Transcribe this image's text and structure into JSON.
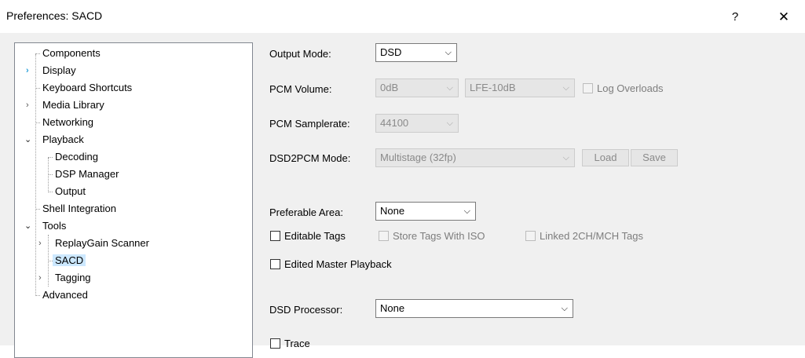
{
  "window": {
    "title": "Preferences: SACD",
    "help_glyph": "?",
    "close_glyph": "✕"
  },
  "tree": {
    "items": [
      {
        "label": "Components"
      },
      {
        "label": "Display",
        "expander": "collapsed-hover"
      },
      {
        "label": "Keyboard Shortcuts"
      },
      {
        "label": "Media Library",
        "expander": "collapsed"
      },
      {
        "label": "Networking"
      },
      {
        "label": "Playback",
        "expander": "expanded"
      },
      {
        "label": "Decoding"
      },
      {
        "label": "DSP Manager"
      },
      {
        "label": "Output"
      },
      {
        "label": "Shell Integration"
      },
      {
        "label": "Tools",
        "expander": "expanded"
      },
      {
        "label": "ReplayGain Scanner",
        "expander": "collapsed"
      },
      {
        "label": "SACD",
        "selected": true
      },
      {
        "label": "Tagging",
        "expander": "collapsed"
      },
      {
        "label": "Advanced"
      }
    ]
  },
  "sacd": {
    "output_mode": {
      "label": "Output Mode:",
      "value": "DSD"
    },
    "pcm_volume": {
      "label": "PCM Volume:",
      "value": "0dB",
      "lfe_value": "LFE-10dB"
    },
    "log_overloads": {
      "label": "Log Overloads",
      "checked": false
    },
    "pcm_samplerate": {
      "label": "PCM Samplerate:",
      "value": "44100"
    },
    "dsd2pcm_mode": {
      "label": "DSD2PCM Mode:",
      "value": "Multistage (32fp)"
    },
    "load_button": "Load",
    "save_button": "Save",
    "preferable_area": {
      "label": "Preferable Area:",
      "value": "None"
    },
    "editable_tags": {
      "label": "Editable Tags",
      "checked": false
    },
    "store_tags_with_iso": {
      "label": "Store Tags With ISO",
      "checked": false
    },
    "linked_tags": {
      "label": "Linked 2CH/MCH Tags",
      "checked": false
    },
    "edited_master_playback": {
      "label": "Edited Master Playback",
      "checked": false
    },
    "dsd_processor": {
      "label": "DSD Processor:",
      "value": "None"
    },
    "trace": {
      "label": "Trace",
      "checked": false
    }
  },
  "icons": {
    "chevron_down": "⌵",
    "chevron_right": "›",
    "chevron_expanded": "⌄"
  }
}
